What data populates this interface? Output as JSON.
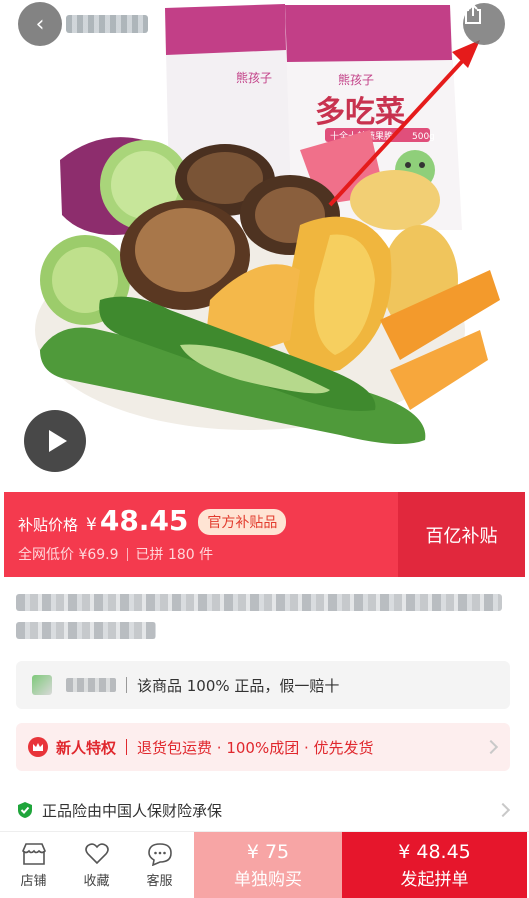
{
  "hero": {
    "package_brand": "熊孩子",
    "package_title": "多吃菜",
    "package_tagline": "十全十美蔬果脆",
    "package_weight": "500g"
  },
  "price_banner": {
    "label": "补贴价格",
    "currency": "¥",
    "price": "48.45",
    "official_tag": "官方补贴品",
    "market_low": "全网低价 ¥69.9",
    "joined": "已拼 180 件",
    "campaign": "百亿补贴"
  },
  "authentic": {
    "text": "该商品 100% 正品，假一赔十"
  },
  "new_user": {
    "label": "新人特权",
    "text": "退货包运费 · 100%成团 · 优先发货"
  },
  "insurance": {
    "text": "正品险由中国人保财险承保"
  },
  "bottom_bar": {
    "store": "店铺",
    "favorite": "收藏",
    "service": "客服",
    "solo_price": "¥ 75",
    "solo_label": "单独购买",
    "group_price": "¥ 48.45",
    "group_label": "发起拼单"
  },
  "colors": {
    "accent": "#f43a4e",
    "group_button": "#e6162c",
    "solo_button": "#f7a5a5",
    "pointer_arrow": "#e51b1b"
  }
}
